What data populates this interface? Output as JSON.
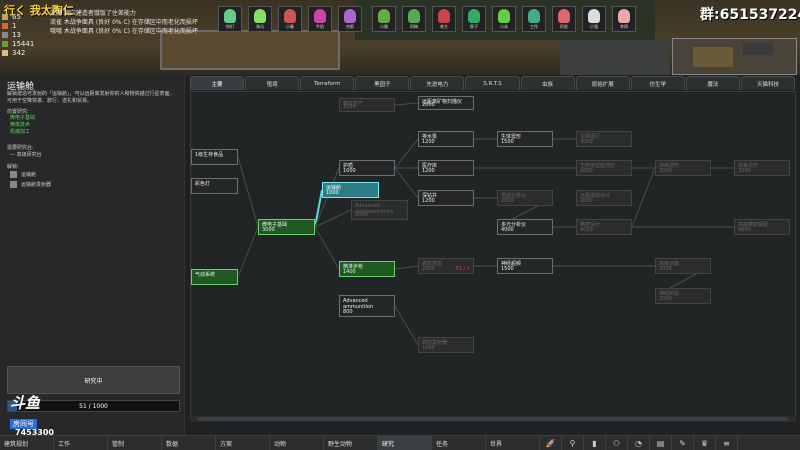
{
  "stream": {
    "title": "行く 我太陶仁",
    "room": "群:651537224",
    "douyu": "斗鱼",
    "douyu_badge": "房间号",
    "room_id": "7453300"
  },
  "alerts": [
    "流民 洞穴建造者饿饭了住差能力",
    "流雀 木战争面具 (良好 0% C) 在存储区中而老化而损坏",
    "哦哦 木战争面具 (良好 0% C) 在存储区中而老化而损坏"
  ],
  "resources": [
    "65",
    "1",
    "13",
    "15441",
    "342"
  ],
  "pawns": [
    {
      "name": "你们",
      "color": "#6c8"
    },
    {
      "name": "海马",
      "color": "#8d6"
    },
    {
      "name": "小春",
      "color": "#c55"
    },
    {
      "name": "牛奶",
      "color": "#c4a"
    },
    {
      "name": "杰斯",
      "color": "#a6c"
    },
    {
      "name": "小猫",
      "color": "#6a4"
    },
    {
      "name": "阿梅",
      "color": "#5a5"
    },
    {
      "name": "老大",
      "color": "#c44"
    },
    {
      "name": "胖子",
      "color": "#3a6"
    },
    {
      "name": "小米",
      "color": "#6c4"
    },
    {
      "name": "工作",
      "color": "#4a8"
    },
    {
      "name": "阿毛",
      "color": "#d66"
    },
    {
      "name": "小强",
      "color": "#ddd"
    },
    {
      "name": "李四",
      "color": "#eaa"
    }
  ],
  "info": {
    "title": "运输舱",
    "desc": "解锁建造可发射的「运输舱」，可以远距离发射你的人和物资越过行星表面。可用于空降突袭、旅行、送礼和贸易。",
    "prereq_label": "前置研究:",
    "prereqs": [
      "微电子基础",
      "精炼技术",
      "机械加工"
    ],
    "bench_label": "需要研究台:",
    "bench": "高级研究台",
    "unlock_label": "解锁:",
    "unlocks": [
      "运输舱",
      "运输舱发射器"
    ],
    "research_button": "研究中",
    "progress_text": "51 / 1000",
    "progress": 0.051
  },
  "tabs": [
    "主要",
    "殖境",
    "Terraform",
    "黑园子",
    "先进电力",
    "S.R.T.S",
    "虫族",
    "原始扩展",
    "仿生学",
    "魔法",
    "天猫科技"
  ],
  "active_tab": 0,
  "nodes": [
    {
      "label": "塞疗生产",
      "cost": "1000",
      "state": "dim"
    },
    {
      "label": "远距离矿物扫描仪",
      "cost": "2000",
      "state": "avail"
    },
    {
      "label": "排水泵",
      "cost": "1200",
      "state": "avail"
    },
    {
      "label": "生体雷形",
      "cost": "1500",
      "state": "avail"
    },
    {
      "label": "生体遗行",
      "cost": "4000",
      "state": "dim"
    },
    {
      "label": "1级生存食品",
      "cost": "",
      "state": "avail"
    },
    {
      "label": "护盾",
      "cost": "1000",
      "state": "avail"
    },
    {
      "label": "医疗床",
      "cost": "1200",
      "state": "avail"
    },
    {
      "label": "生命体征监测仪",
      "cost": "2000",
      "state": "dim"
    },
    {
      "label": "持续调节",
      "cost": "3000",
      "state": "dim"
    },
    {
      "label": "高等调节",
      "cost": "3000",
      "state": "dim"
    },
    {
      "label": "彩色灯",
      "cost": "",
      "state": "avail"
    },
    {
      "label": "运输舱",
      "cost": "1000",
      "state": "cur"
    },
    {
      "label": "深钻井",
      "cost": "1200",
      "state": "avail"
    },
    {
      "label": "雪盗分析仪",
      "cost": "2000",
      "state": "dim"
    },
    {
      "label": "远程游戏设计",
      "cost": "2000",
      "state": "dim"
    },
    {
      "label": "Advanced optoelectronics",
      "cost": "1000",
      "state": "dim"
    },
    {
      "label": "微电子基础",
      "cost": "3000",
      "state": "done"
    },
    {
      "label": "多元分析仪",
      "cost": "4000",
      "state": "avail"
    },
    {
      "label": "精密设计",
      "cost": "4000",
      "state": "dim"
    },
    {
      "label": "高级精密装配",
      "cost": "4000",
      "state": "dim"
    },
    {
      "label": "气动系统",
      "cost": "",
      "state": "done"
    },
    {
      "label": "精准步枪",
      "cost": "1400",
      "state": "done"
    },
    {
      "label": "跳跃技能",
      "cost": "2000",
      "state": "dim",
      "extra": "51 / 1"
    },
    {
      "label": "神经超频",
      "cost": "1500",
      "state": "avail"
    },
    {
      "label": "高级功能",
      "cost": "2000",
      "state": "dim"
    },
    {
      "label": "神经制造",
      "cost": "2000",
      "state": "dim"
    },
    {
      "label": "Advanced ammunition",
      "cost": "800",
      "state": "avail"
    },
    {
      "label": "疏忽发射器",
      "cost": "1000",
      "state": "dim"
    }
  ],
  "bottom": {
    "buttons": [
      "建筑规划",
      "工作",
      "管制",
      "数据",
      "方案",
      "动物",
      "野生动物",
      "研究",
      "任务",
      "世界"
    ],
    "active": 7,
    "icons": [
      "rocket-icon",
      "search-icon",
      "book-icon",
      "people-icon",
      "lightbulb-icon",
      "bars-icon",
      "brush-icon",
      "trophy-icon",
      "menu-icon"
    ],
    "glyphs": [
      "🚀",
      "⚲",
      "▮",
      "⚇",
      "◔",
      "▤",
      "✎",
      "♛",
      "≡"
    ]
  }
}
